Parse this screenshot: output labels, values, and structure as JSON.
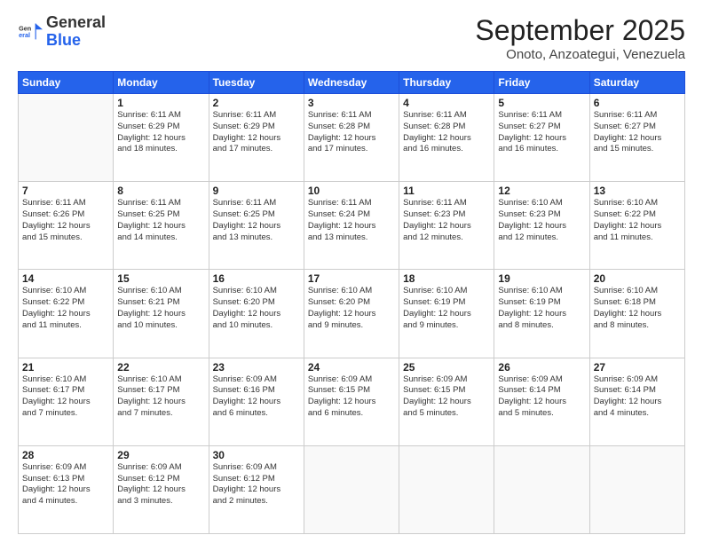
{
  "header": {
    "logo_general": "General",
    "logo_blue": "Blue",
    "month_title": "September 2025",
    "location": "Onoto, Anzoategui, Venezuela"
  },
  "days_of_week": [
    "Sunday",
    "Monday",
    "Tuesday",
    "Wednesday",
    "Thursday",
    "Friday",
    "Saturday"
  ],
  "weeks": [
    [
      {
        "day": "",
        "info": ""
      },
      {
        "day": "1",
        "info": "Sunrise: 6:11 AM\nSunset: 6:29 PM\nDaylight: 12 hours\nand 18 minutes."
      },
      {
        "day": "2",
        "info": "Sunrise: 6:11 AM\nSunset: 6:29 PM\nDaylight: 12 hours\nand 17 minutes."
      },
      {
        "day": "3",
        "info": "Sunrise: 6:11 AM\nSunset: 6:28 PM\nDaylight: 12 hours\nand 17 minutes."
      },
      {
        "day": "4",
        "info": "Sunrise: 6:11 AM\nSunset: 6:28 PM\nDaylight: 12 hours\nand 16 minutes."
      },
      {
        "day": "5",
        "info": "Sunrise: 6:11 AM\nSunset: 6:27 PM\nDaylight: 12 hours\nand 16 minutes."
      },
      {
        "day": "6",
        "info": "Sunrise: 6:11 AM\nSunset: 6:27 PM\nDaylight: 12 hours\nand 15 minutes."
      }
    ],
    [
      {
        "day": "7",
        "info": "Sunrise: 6:11 AM\nSunset: 6:26 PM\nDaylight: 12 hours\nand 15 minutes."
      },
      {
        "day": "8",
        "info": "Sunrise: 6:11 AM\nSunset: 6:25 PM\nDaylight: 12 hours\nand 14 minutes."
      },
      {
        "day": "9",
        "info": "Sunrise: 6:11 AM\nSunset: 6:25 PM\nDaylight: 12 hours\nand 13 minutes."
      },
      {
        "day": "10",
        "info": "Sunrise: 6:11 AM\nSunset: 6:24 PM\nDaylight: 12 hours\nand 13 minutes."
      },
      {
        "day": "11",
        "info": "Sunrise: 6:11 AM\nSunset: 6:23 PM\nDaylight: 12 hours\nand 12 minutes."
      },
      {
        "day": "12",
        "info": "Sunrise: 6:10 AM\nSunset: 6:23 PM\nDaylight: 12 hours\nand 12 minutes."
      },
      {
        "day": "13",
        "info": "Sunrise: 6:10 AM\nSunset: 6:22 PM\nDaylight: 12 hours\nand 11 minutes."
      }
    ],
    [
      {
        "day": "14",
        "info": "Sunrise: 6:10 AM\nSunset: 6:22 PM\nDaylight: 12 hours\nand 11 minutes."
      },
      {
        "day": "15",
        "info": "Sunrise: 6:10 AM\nSunset: 6:21 PM\nDaylight: 12 hours\nand 10 minutes."
      },
      {
        "day": "16",
        "info": "Sunrise: 6:10 AM\nSunset: 6:20 PM\nDaylight: 12 hours\nand 10 minutes."
      },
      {
        "day": "17",
        "info": "Sunrise: 6:10 AM\nSunset: 6:20 PM\nDaylight: 12 hours\nand 9 minutes."
      },
      {
        "day": "18",
        "info": "Sunrise: 6:10 AM\nSunset: 6:19 PM\nDaylight: 12 hours\nand 9 minutes."
      },
      {
        "day": "19",
        "info": "Sunrise: 6:10 AM\nSunset: 6:19 PM\nDaylight: 12 hours\nand 8 minutes."
      },
      {
        "day": "20",
        "info": "Sunrise: 6:10 AM\nSunset: 6:18 PM\nDaylight: 12 hours\nand 8 minutes."
      }
    ],
    [
      {
        "day": "21",
        "info": "Sunrise: 6:10 AM\nSunset: 6:17 PM\nDaylight: 12 hours\nand 7 minutes."
      },
      {
        "day": "22",
        "info": "Sunrise: 6:10 AM\nSunset: 6:17 PM\nDaylight: 12 hours\nand 7 minutes."
      },
      {
        "day": "23",
        "info": "Sunrise: 6:09 AM\nSunset: 6:16 PM\nDaylight: 12 hours\nand 6 minutes."
      },
      {
        "day": "24",
        "info": "Sunrise: 6:09 AM\nSunset: 6:15 PM\nDaylight: 12 hours\nand 6 minutes."
      },
      {
        "day": "25",
        "info": "Sunrise: 6:09 AM\nSunset: 6:15 PM\nDaylight: 12 hours\nand 5 minutes."
      },
      {
        "day": "26",
        "info": "Sunrise: 6:09 AM\nSunset: 6:14 PM\nDaylight: 12 hours\nand 5 minutes."
      },
      {
        "day": "27",
        "info": "Sunrise: 6:09 AM\nSunset: 6:14 PM\nDaylight: 12 hours\nand 4 minutes."
      }
    ],
    [
      {
        "day": "28",
        "info": "Sunrise: 6:09 AM\nSunset: 6:13 PM\nDaylight: 12 hours\nand 4 minutes."
      },
      {
        "day": "29",
        "info": "Sunrise: 6:09 AM\nSunset: 6:12 PM\nDaylight: 12 hours\nand 3 minutes."
      },
      {
        "day": "30",
        "info": "Sunrise: 6:09 AM\nSunset: 6:12 PM\nDaylight: 12 hours\nand 2 minutes."
      },
      {
        "day": "",
        "info": ""
      },
      {
        "day": "",
        "info": ""
      },
      {
        "day": "",
        "info": ""
      },
      {
        "day": "",
        "info": ""
      }
    ]
  ]
}
